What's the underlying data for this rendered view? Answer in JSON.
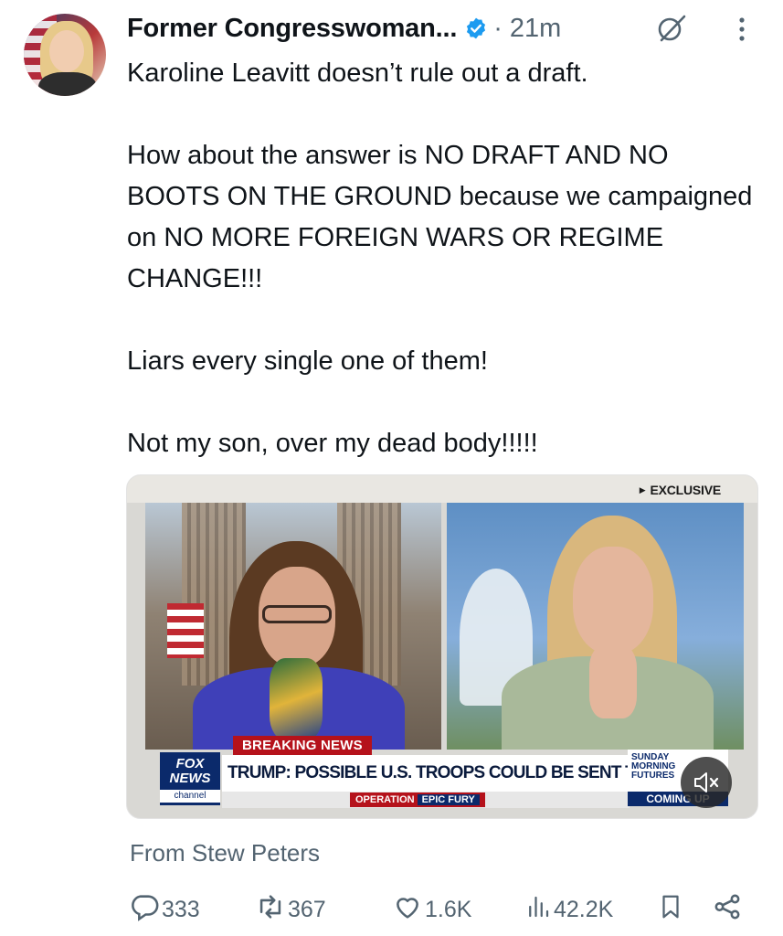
{
  "post": {
    "author_name": "Former Congresswoman...",
    "separator_time": "· 21m",
    "paragraphs": [
      "Karoline Leavitt doesn’t rule out a draft.",
      "How about the answer is NO DRAFT AND NO BOOTS ON THE GROUND because we campaigned on NO MORE FOREIGN WARS OR REGIME CHANGE!!!",
      "Liars every single one of them!",
      "Not my son, over my dead body!!!!!"
    ],
    "source_text": "From Stew Peters"
  },
  "media": {
    "exclusive_label": "EXCLUSIVE",
    "breaking_label": "BREAKING NEWS",
    "headline": "TRUMP: POSSIBLE U.S. TROOPS COULD BE SENT TO IRAN",
    "logo_line1": "FOX",
    "logo_line2": "NEWS",
    "logo_line3": "channel",
    "operation_label": "OPERATION",
    "operation_name": "EPIC FURY",
    "sunday_line1": "SUNDAY",
    "sunday_line2": "MORNING",
    "sunday_line3": "FUTURES",
    "coming_up": "COMING UP"
  },
  "actions": {
    "replies": "333",
    "reposts": "367",
    "likes": "1.6K",
    "views": "42.2K"
  },
  "colors": {
    "verified_blue": "#1d9bf0",
    "secondary_text": "#536471",
    "breaking_red": "#b5121b",
    "fox_navy": "#0b2a6b"
  },
  "icons": [
    "verified-badge-icon",
    "grok-icon",
    "more-icon",
    "reply-icon",
    "repost-icon",
    "like-icon",
    "views-icon",
    "bookmark-icon",
    "share-icon",
    "mute-icon"
  ]
}
